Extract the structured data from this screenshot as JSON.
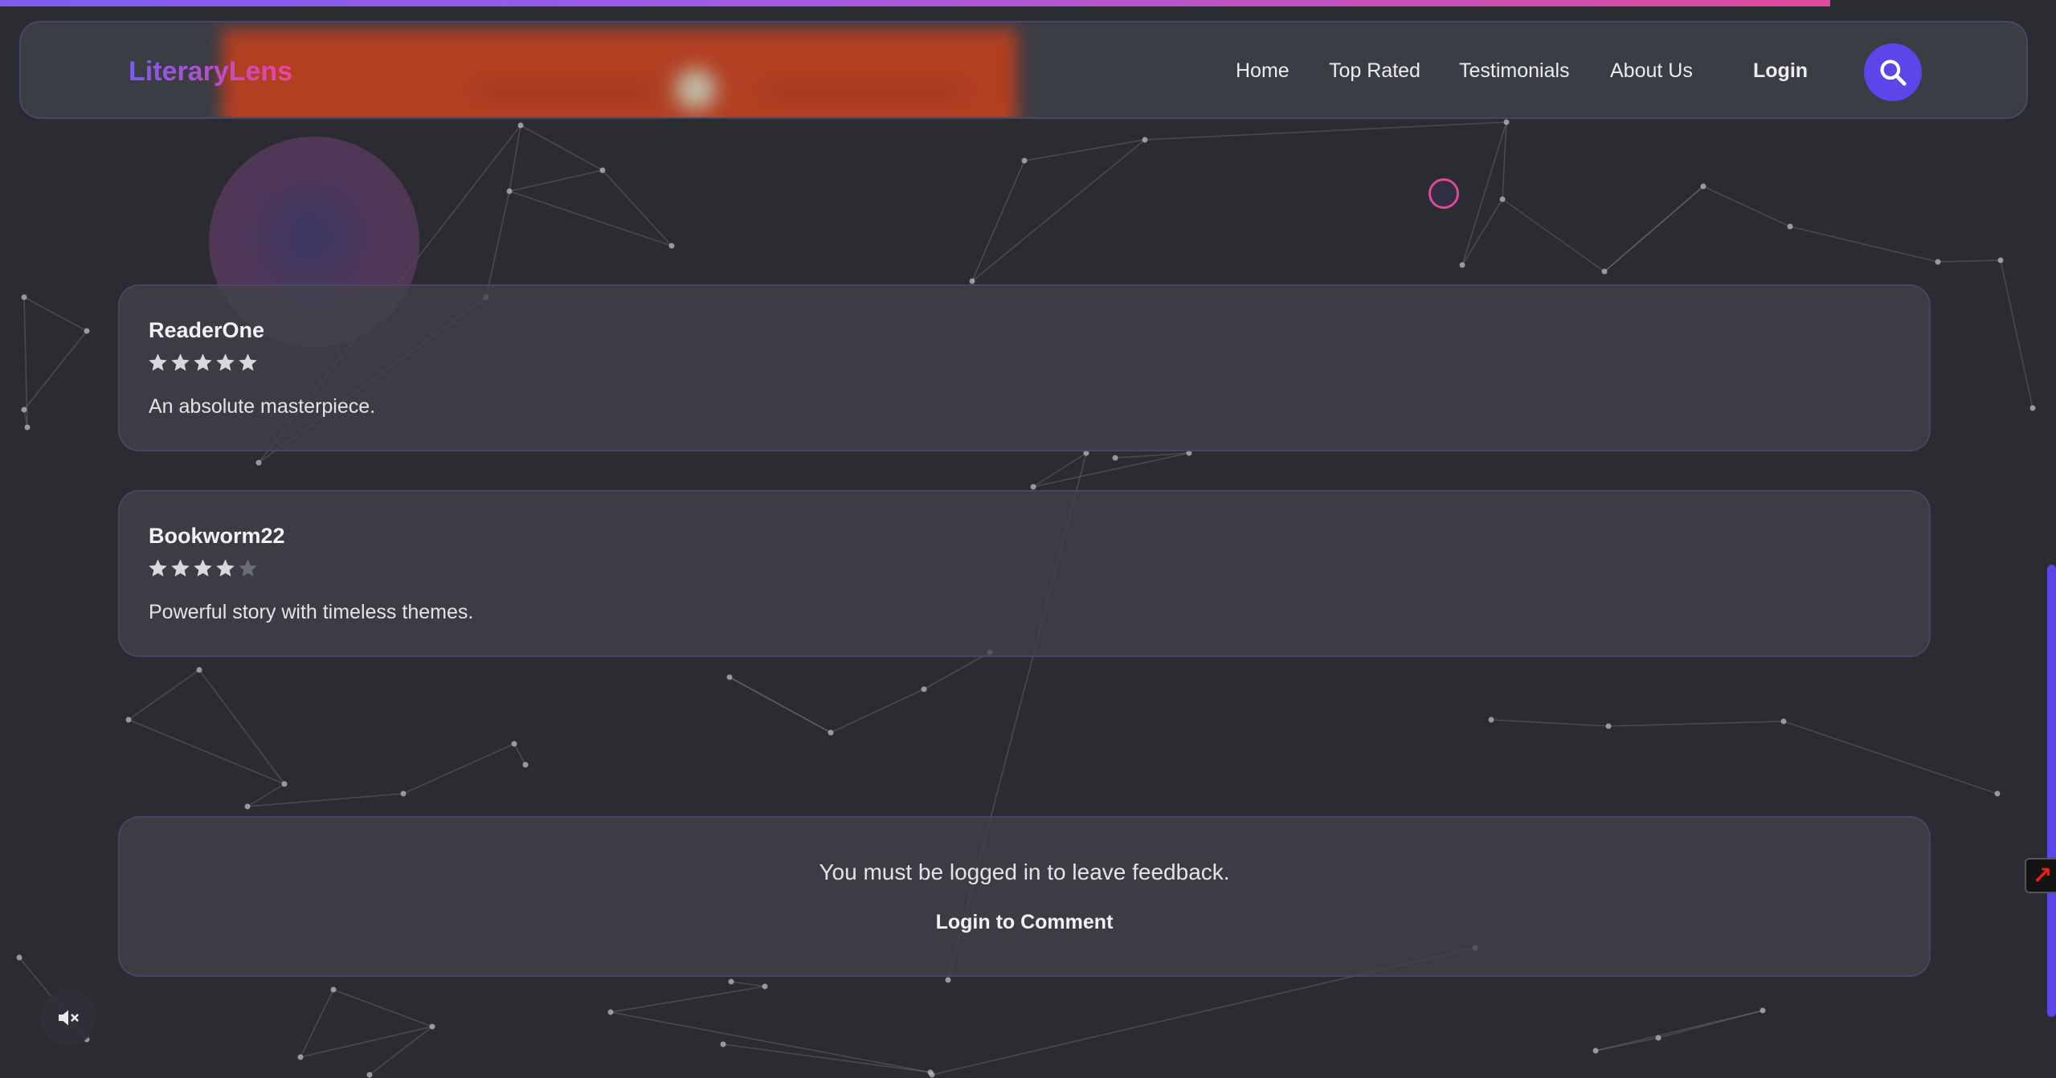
{
  "brand": {
    "name": "LiteraryLens"
  },
  "nav": {
    "items": [
      {
        "label": "Home"
      },
      {
        "label": "Top Rated"
      },
      {
        "label": "Testimonials"
      },
      {
        "label": "About Us"
      }
    ],
    "login_label": "Login",
    "search_icon": "search-icon"
  },
  "reviews": [
    {
      "author": "ReaderOne",
      "rating": 5,
      "max_rating": 5,
      "text": "An absolute masterpiece."
    },
    {
      "author": "Bookworm22",
      "rating": 4,
      "max_rating": 5,
      "text": "Powerful story with timeless themes."
    }
  ],
  "login_prompt": {
    "message": "You must be logged in to leave feedback.",
    "button_label": "Login to Comment"
  },
  "controls": {
    "mute_icon": "mute-icon"
  },
  "progress": {
    "fraction": 0.89
  },
  "colors": {
    "background": "#2b2c31",
    "accent": "#5b46ea",
    "brand_gradient_start": "#7b5cf0",
    "brand_gradient_end": "#f0479a",
    "star_filled": "#d9d9dd",
    "star_empty": "#6b6e78",
    "ring": "#e0499a"
  }
}
